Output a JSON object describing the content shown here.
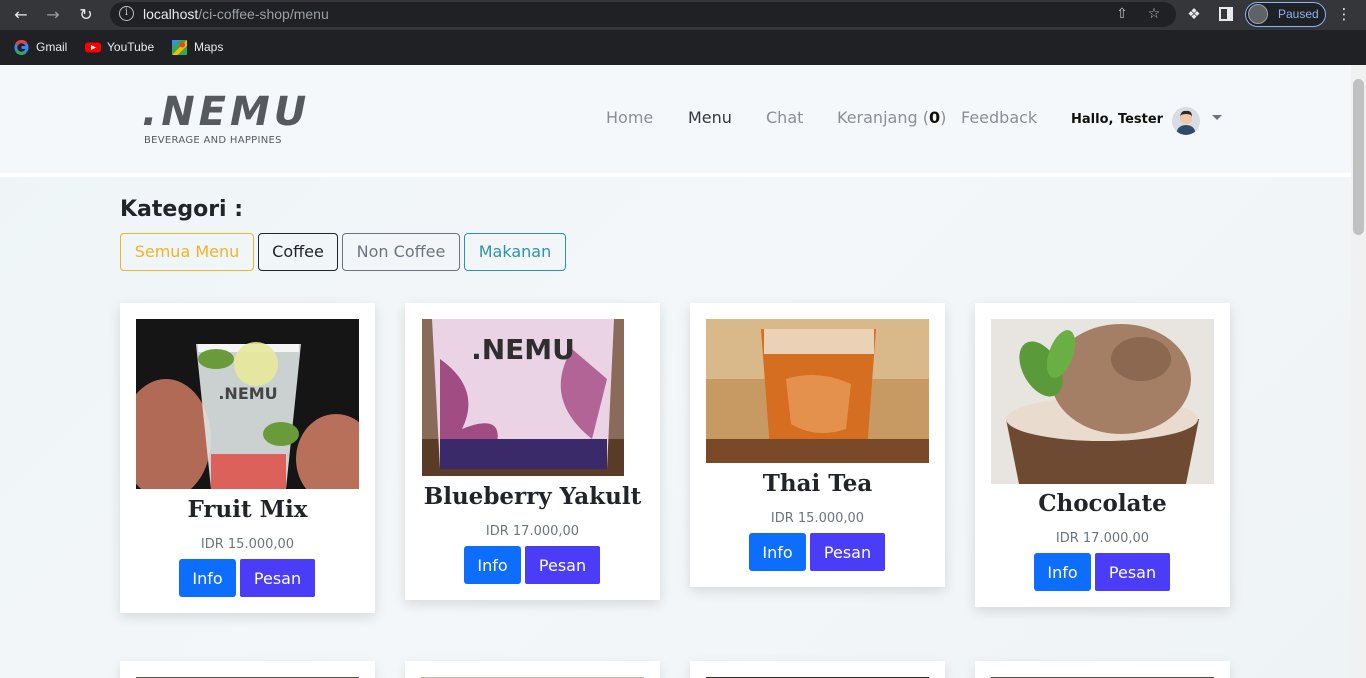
{
  "browser": {
    "url_host": "localhost",
    "url_path": "/ci-coffee-shop/menu",
    "profile_status": "Paused",
    "bookmarks": [
      {
        "label": "Gmail",
        "icon": "google-icon"
      },
      {
        "label": "YouTube",
        "icon": "youtube-icon"
      },
      {
        "label": "Maps",
        "icon": "maps-icon"
      }
    ]
  },
  "header": {
    "logo_main": ".NEMU",
    "logo_sub": "BEVERAGE AND HAPPINES",
    "nav": {
      "home": "Home",
      "menu": "Menu",
      "chat": "Chat",
      "cart_label": "Keranjang (",
      "cart_count": "0",
      "cart_close": ")",
      "feedback": "Feedback"
    },
    "greeting": "Hallo, Tester"
  },
  "categories": {
    "title": "Kategori :",
    "buttons": [
      "Semua Menu",
      "Coffee",
      "Non Coffee",
      "Makanan"
    ]
  },
  "products": [
    {
      "name": "Fruit Mix",
      "price": "IDR 15.000,00",
      "info": "Info",
      "order": "Pesan"
    },
    {
      "name": "Blueberry Yakult",
      "price": "IDR 17.000,00",
      "info": "Info",
      "order": "Pesan"
    },
    {
      "name": "Thai Tea",
      "price": "IDR 15.000,00",
      "info": "Info",
      "order": "Pesan"
    },
    {
      "name": "Chocolate",
      "price": "IDR 17.000,00",
      "info": "Info",
      "order": "Pesan"
    }
  ],
  "colors": {
    "accent_info": "#0d6efd",
    "accent_order": "#4a3cf7",
    "cat_all": "#f0b429",
    "cat_coffee": "#212529",
    "cat_noncoffee": "#6c757d",
    "cat_food": "#2a93b0"
  }
}
